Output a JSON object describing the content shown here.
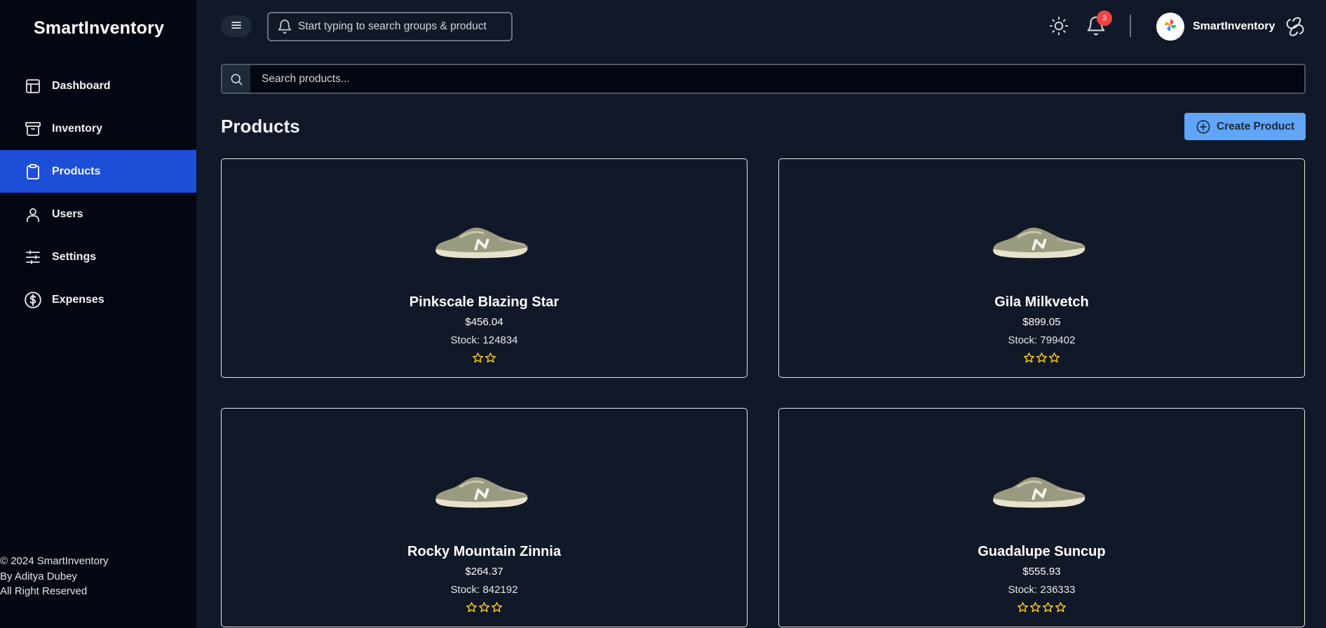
{
  "brand": "SmartInventory",
  "sidebar": {
    "items": [
      {
        "label": "Dashboard",
        "icon": "layout-icon",
        "active": false
      },
      {
        "label": "Inventory",
        "icon": "archive-icon",
        "active": false
      },
      {
        "label": "Products",
        "icon": "clipboard-icon",
        "active": true
      },
      {
        "label": "Users",
        "icon": "user-icon",
        "active": false
      },
      {
        "label": "Settings",
        "icon": "sliders-icon",
        "active": false
      },
      {
        "label": "Expenses",
        "icon": "dollar-circle-icon",
        "active": false
      }
    ],
    "footer": {
      "line1": "© 2024 SmartInventory",
      "line2": "By Aditya Dubey",
      "line3": "All Right Reserved"
    }
  },
  "topbar": {
    "search_placeholder": "Start typing to search groups & product",
    "notification_count": "3",
    "user_name": "SmartInventory"
  },
  "main": {
    "search_placeholder": "Search products...",
    "title": "Products",
    "create_label": "Create Product"
  },
  "products": [
    {
      "name": "Pinkscale Blazing Star",
      "price": "$456.04",
      "stock": "Stock: 124834",
      "rating": 2
    },
    {
      "name": "Gila Milkvetch",
      "price": "$899.05",
      "stock": "Stock: 799402",
      "rating": 3
    },
    {
      "name": "Rocky Mountain Zinnia",
      "price": "$264.37",
      "stock": "Stock: 842192",
      "rating": 3
    },
    {
      "name": "Guadalupe Suncup",
      "price": "$555.93",
      "stock": "Stock: 236333",
      "rating": 4
    }
  ],
  "colors": {
    "sidebar_bg": "#030712",
    "page_bg": "#111827",
    "active_nav": "#1d4ed8",
    "create_button": "#60a5fa",
    "star": "#facc15",
    "badge": "#ef4444"
  }
}
